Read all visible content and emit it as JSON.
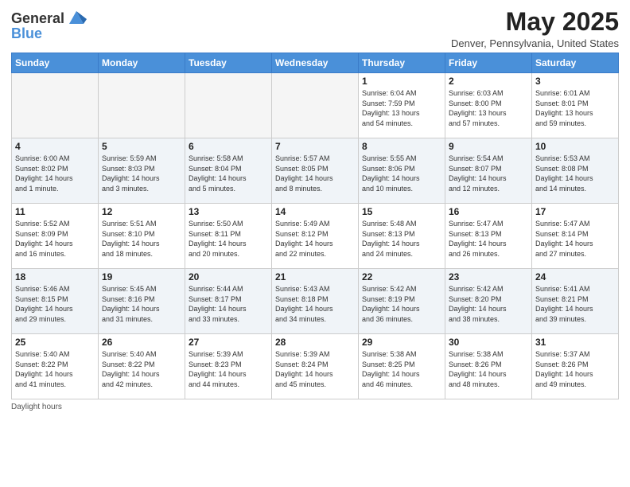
{
  "header": {
    "logo_line1": "General",
    "logo_line2": "Blue",
    "month_title": "May 2025",
    "location": "Denver, Pennsylvania, United States"
  },
  "days_of_week": [
    "Sunday",
    "Monday",
    "Tuesday",
    "Wednesday",
    "Thursday",
    "Friday",
    "Saturday"
  ],
  "weeks": [
    [
      {
        "day": "",
        "info": ""
      },
      {
        "day": "",
        "info": ""
      },
      {
        "day": "",
        "info": ""
      },
      {
        "day": "",
        "info": ""
      },
      {
        "day": "1",
        "info": "Sunrise: 6:04 AM\nSunset: 7:59 PM\nDaylight: 13 hours\nand 54 minutes."
      },
      {
        "day": "2",
        "info": "Sunrise: 6:03 AM\nSunset: 8:00 PM\nDaylight: 13 hours\nand 57 minutes."
      },
      {
        "day": "3",
        "info": "Sunrise: 6:01 AM\nSunset: 8:01 PM\nDaylight: 13 hours\nand 59 minutes."
      }
    ],
    [
      {
        "day": "4",
        "info": "Sunrise: 6:00 AM\nSunset: 8:02 PM\nDaylight: 14 hours\nand 1 minute."
      },
      {
        "day": "5",
        "info": "Sunrise: 5:59 AM\nSunset: 8:03 PM\nDaylight: 14 hours\nand 3 minutes."
      },
      {
        "day": "6",
        "info": "Sunrise: 5:58 AM\nSunset: 8:04 PM\nDaylight: 14 hours\nand 5 minutes."
      },
      {
        "day": "7",
        "info": "Sunrise: 5:57 AM\nSunset: 8:05 PM\nDaylight: 14 hours\nand 8 minutes."
      },
      {
        "day": "8",
        "info": "Sunrise: 5:55 AM\nSunset: 8:06 PM\nDaylight: 14 hours\nand 10 minutes."
      },
      {
        "day": "9",
        "info": "Sunrise: 5:54 AM\nSunset: 8:07 PM\nDaylight: 14 hours\nand 12 minutes."
      },
      {
        "day": "10",
        "info": "Sunrise: 5:53 AM\nSunset: 8:08 PM\nDaylight: 14 hours\nand 14 minutes."
      }
    ],
    [
      {
        "day": "11",
        "info": "Sunrise: 5:52 AM\nSunset: 8:09 PM\nDaylight: 14 hours\nand 16 minutes."
      },
      {
        "day": "12",
        "info": "Sunrise: 5:51 AM\nSunset: 8:10 PM\nDaylight: 14 hours\nand 18 minutes."
      },
      {
        "day": "13",
        "info": "Sunrise: 5:50 AM\nSunset: 8:11 PM\nDaylight: 14 hours\nand 20 minutes."
      },
      {
        "day": "14",
        "info": "Sunrise: 5:49 AM\nSunset: 8:12 PM\nDaylight: 14 hours\nand 22 minutes."
      },
      {
        "day": "15",
        "info": "Sunrise: 5:48 AM\nSunset: 8:13 PM\nDaylight: 14 hours\nand 24 minutes."
      },
      {
        "day": "16",
        "info": "Sunrise: 5:47 AM\nSunset: 8:13 PM\nDaylight: 14 hours\nand 26 minutes."
      },
      {
        "day": "17",
        "info": "Sunrise: 5:47 AM\nSunset: 8:14 PM\nDaylight: 14 hours\nand 27 minutes."
      }
    ],
    [
      {
        "day": "18",
        "info": "Sunrise: 5:46 AM\nSunset: 8:15 PM\nDaylight: 14 hours\nand 29 minutes."
      },
      {
        "day": "19",
        "info": "Sunrise: 5:45 AM\nSunset: 8:16 PM\nDaylight: 14 hours\nand 31 minutes."
      },
      {
        "day": "20",
        "info": "Sunrise: 5:44 AM\nSunset: 8:17 PM\nDaylight: 14 hours\nand 33 minutes."
      },
      {
        "day": "21",
        "info": "Sunrise: 5:43 AM\nSunset: 8:18 PM\nDaylight: 14 hours\nand 34 minutes."
      },
      {
        "day": "22",
        "info": "Sunrise: 5:42 AM\nSunset: 8:19 PM\nDaylight: 14 hours\nand 36 minutes."
      },
      {
        "day": "23",
        "info": "Sunrise: 5:42 AM\nSunset: 8:20 PM\nDaylight: 14 hours\nand 38 minutes."
      },
      {
        "day": "24",
        "info": "Sunrise: 5:41 AM\nSunset: 8:21 PM\nDaylight: 14 hours\nand 39 minutes."
      }
    ],
    [
      {
        "day": "25",
        "info": "Sunrise: 5:40 AM\nSunset: 8:22 PM\nDaylight: 14 hours\nand 41 minutes."
      },
      {
        "day": "26",
        "info": "Sunrise: 5:40 AM\nSunset: 8:22 PM\nDaylight: 14 hours\nand 42 minutes."
      },
      {
        "day": "27",
        "info": "Sunrise: 5:39 AM\nSunset: 8:23 PM\nDaylight: 14 hours\nand 44 minutes."
      },
      {
        "day": "28",
        "info": "Sunrise: 5:39 AM\nSunset: 8:24 PM\nDaylight: 14 hours\nand 45 minutes."
      },
      {
        "day": "29",
        "info": "Sunrise: 5:38 AM\nSunset: 8:25 PM\nDaylight: 14 hours\nand 46 minutes."
      },
      {
        "day": "30",
        "info": "Sunrise: 5:38 AM\nSunset: 8:26 PM\nDaylight: 14 hours\nand 48 minutes."
      },
      {
        "day": "31",
        "info": "Sunrise: 5:37 AM\nSunset: 8:26 PM\nDaylight: 14 hours\nand 49 minutes."
      }
    ]
  ],
  "footer": {
    "note": "Daylight hours"
  }
}
